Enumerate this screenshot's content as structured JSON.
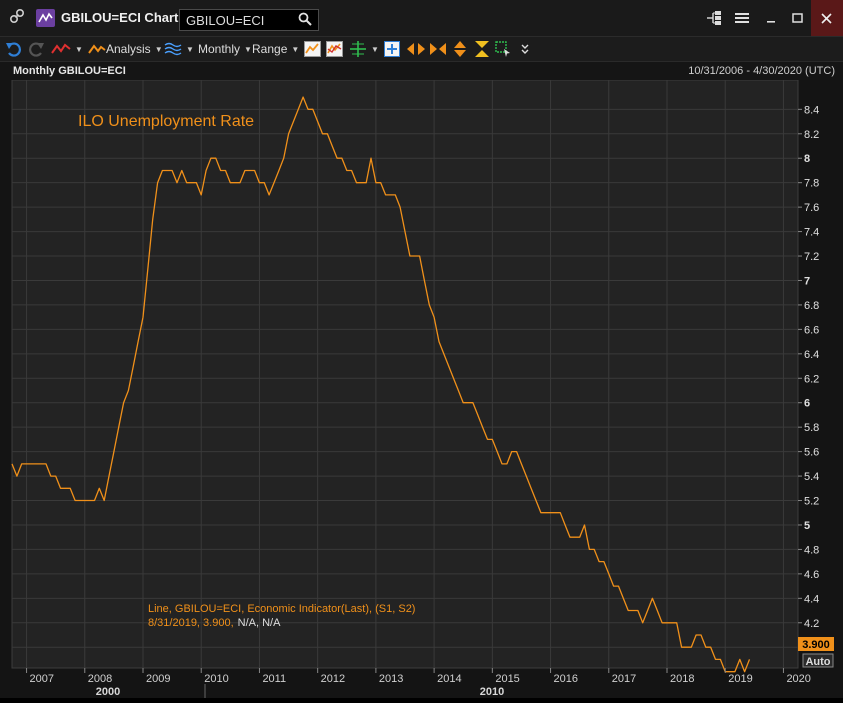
{
  "window": {
    "title": "GBILOU=ECI Chart",
    "ric_value": "GBILOU=ECI"
  },
  "toolbar": {
    "analysis_label": "Analysis",
    "interval_label": "Monthly",
    "range_label": "Range"
  },
  "chart_header": {
    "title": "Monthly GBILOU=ECI",
    "date_range": "10/31/2006 - 4/30/2020 (UTC)"
  },
  "colors": {
    "line": "#f0901a",
    "accent": "#f0901a",
    "background": "#232323",
    "grid": "#3a3a3a"
  },
  "chart_data": {
    "type": "line",
    "title": "ILO Unemployment Rate",
    "info_line1": "Line, GBILOU=ECI, Economic Indicator(Last), (S1, S2)",
    "info_date_value": "8/31/2019, 3.900,",
    "info_na": "N/A, N/A",
    "last_value_label": "3.900",
    "auto_label": "Auto",
    "x_major_labels": [
      "2000",
      "2010"
    ],
    "x_ticks": [
      "2007",
      "2008",
      "2009",
      "2010",
      "2011",
      "2012",
      "2013",
      "2014",
      "2015",
      "2016",
      "2017",
      "2018",
      "2019",
      "2020"
    ],
    "y_ticks": [
      "4",
      "4.2",
      "4.4",
      "4.6",
      "4.8",
      "5",
      "5.2",
      "5.4",
      "5.6",
      "5.8",
      "6",
      "6.2",
      "6.4",
      "6.6",
      "6.8",
      "7",
      "7.2",
      "7.4",
      "7.6",
      "7.8",
      "8",
      "8.2",
      "8.4"
    ],
    "xlim": [
      "2006-10",
      "2020-04"
    ],
    "ylim": [
      3.83,
      8.64
    ],
    "grid": true,
    "series": [
      {
        "values": [
          [
            "2006-10",
            5.5
          ],
          [
            "2006-11",
            5.4
          ],
          [
            "2006-12",
            5.5
          ],
          [
            "2007-01",
            5.5
          ],
          [
            "2007-03",
            5.5
          ],
          [
            "2007-05",
            5.5
          ],
          [
            "2007-06",
            5.4
          ],
          [
            "2007-07",
            5.4
          ],
          [
            "2007-08",
            5.3
          ],
          [
            "2007-10",
            5.3
          ],
          [
            "2007-11",
            5.2
          ],
          [
            "2008-03",
            5.2
          ],
          [
            "2008-04",
            5.3
          ],
          [
            "2008-05",
            5.2
          ],
          [
            "2008-06",
            5.4
          ],
          [
            "2008-07",
            5.6
          ],
          [
            "2008-08",
            5.8
          ],
          [
            "2008-09",
            6.0
          ],
          [
            "2008-10",
            6.1
          ],
          [
            "2008-11",
            6.3
          ],
          [
            "2008-12",
            6.5
          ],
          [
            "2009-01",
            6.7
          ],
          [
            "2009-02",
            7.1
          ],
          [
            "2009-03",
            7.5
          ],
          [
            "2009-04",
            7.8
          ],
          [
            "2009-05",
            7.9
          ],
          [
            "2009-07",
            7.9
          ],
          [
            "2009-08",
            7.8
          ],
          [
            "2009-09",
            7.9
          ],
          [
            "2009-10",
            7.8
          ],
          [
            "2009-11",
            7.8
          ],
          [
            "2009-12",
            7.8
          ],
          [
            "2010-01",
            7.7
          ],
          [
            "2010-02",
            7.9
          ],
          [
            "2010-03",
            8.0
          ],
          [
            "2010-04",
            8.0
          ],
          [
            "2010-05",
            7.9
          ],
          [
            "2010-06",
            7.9
          ],
          [
            "2010-07",
            7.8
          ],
          [
            "2010-09",
            7.8
          ],
          [
            "2010-10",
            7.9
          ],
          [
            "2010-12",
            7.9
          ],
          [
            "2011-01",
            7.8
          ],
          [
            "2011-02",
            7.8
          ],
          [
            "2011-03",
            7.7
          ],
          [
            "2011-04",
            7.8
          ],
          [
            "2011-05",
            7.9
          ],
          [
            "2011-06",
            8.0
          ],
          [
            "2011-07",
            8.2
          ],
          [
            "2011-08",
            8.3
          ],
          [
            "2011-09",
            8.4
          ],
          [
            "2011-10",
            8.5
          ],
          [
            "2011-11",
            8.4
          ],
          [
            "2011-12",
            8.4
          ],
          [
            "2012-01",
            8.3
          ],
          [
            "2012-02",
            8.2
          ],
          [
            "2012-03",
            8.2
          ],
          [
            "2012-04",
            8.1
          ],
          [
            "2012-05",
            8.0
          ],
          [
            "2012-06",
            8.0
          ],
          [
            "2012-07",
            7.9
          ],
          [
            "2012-08",
            7.9
          ],
          [
            "2012-09",
            7.8
          ],
          [
            "2012-10",
            7.8
          ],
          [
            "2012-11",
            7.8
          ],
          [
            "2012-12",
            8.0
          ],
          [
            "2013-01",
            7.8
          ],
          [
            "2013-02",
            7.8
          ],
          [
            "2013-03",
            7.7
          ],
          [
            "2013-04",
            7.7
          ],
          [
            "2013-05",
            7.7
          ],
          [
            "2013-06",
            7.6
          ],
          [
            "2013-07",
            7.4
          ],
          [
            "2013-08",
            7.2
          ],
          [
            "2013-09",
            7.2
          ],
          [
            "2013-10",
            7.2
          ],
          [
            "2013-11",
            7.0
          ],
          [
            "2013-12",
            6.8
          ],
          [
            "2014-01",
            6.7
          ],
          [
            "2014-02",
            6.5
          ],
          [
            "2014-03",
            6.4
          ],
          [
            "2014-04",
            6.3
          ],
          [
            "2014-05",
            6.2
          ],
          [
            "2014-06",
            6.1
          ],
          [
            "2014-07",
            6.0
          ],
          [
            "2014-08",
            6.0
          ],
          [
            "2014-09",
            6.0
          ],
          [
            "2014-10",
            5.9
          ],
          [
            "2014-11",
            5.8
          ],
          [
            "2014-12",
            5.7
          ],
          [
            "2015-01",
            5.7
          ],
          [
            "2015-02",
            5.6
          ],
          [
            "2015-03",
            5.5
          ],
          [
            "2015-04",
            5.5
          ],
          [
            "2015-05",
            5.6
          ],
          [
            "2015-06",
            5.6
          ],
          [
            "2015-07",
            5.5
          ],
          [
            "2015-08",
            5.4
          ],
          [
            "2015-09",
            5.3
          ],
          [
            "2015-10",
            5.2
          ],
          [
            "2015-11",
            5.1
          ],
          [
            "2015-12",
            5.1
          ],
          [
            "2016-01",
            5.1
          ],
          [
            "2016-02",
            5.1
          ],
          [
            "2016-03",
            5.1
          ],
          [
            "2016-04",
            5.0
          ],
          [
            "2016-05",
            4.9
          ],
          [
            "2016-06",
            4.9
          ],
          [
            "2016-07",
            4.9
          ],
          [
            "2016-08",
            5.0
          ],
          [
            "2016-09",
            4.8
          ],
          [
            "2016-10",
            4.8
          ],
          [
            "2016-11",
            4.7
          ],
          [
            "2016-12",
            4.7
          ],
          [
            "2017-01",
            4.6
          ],
          [
            "2017-02",
            4.5
          ],
          [
            "2017-03",
            4.5
          ],
          [
            "2017-04",
            4.4
          ],
          [
            "2017-05",
            4.3
          ],
          [
            "2017-06",
            4.3
          ],
          [
            "2017-07",
            4.3
          ],
          [
            "2017-08",
            4.2
          ],
          [
            "2017-09",
            4.3
          ],
          [
            "2017-10",
            4.4
          ],
          [
            "2017-11",
            4.3
          ],
          [
            "2017-12",
            4.2
          ],
          [
            "2018-01",
            4.2
          ],
          [
            "2018-02",
            4.2
          ],
          [
            "2018-03",
            4.2
          ],
          [
            "2018-04",
            4.0
          ],
          [
            "2018-05",
            4.0
          ],
          [
            "2018-06",
            4.0
          ],
          [
            "2018-07",
            4.1
          ],
          [
            "2018-08",
            4.1
          ],
          [
            "2018-09",
            4.0
          ],
          [
            "2018-10",
            4.0
          ],
          [
            "2018-11",
            3.9
          ],
          [
            "2018-12",
            3.9
          ],
          [
            "2019-01",
            3.8
          ],
          [
            "2019-02",
            3.8
          ],
          [
            "2019-03",
            3.8
          ],
          [
            "2019-04",
            3.9
          ],
          [
            "2019-05",
            3.8
          ],
          [
            "2019-06",
            3.9
          ]
        ]
      }
    ]
  }
}
